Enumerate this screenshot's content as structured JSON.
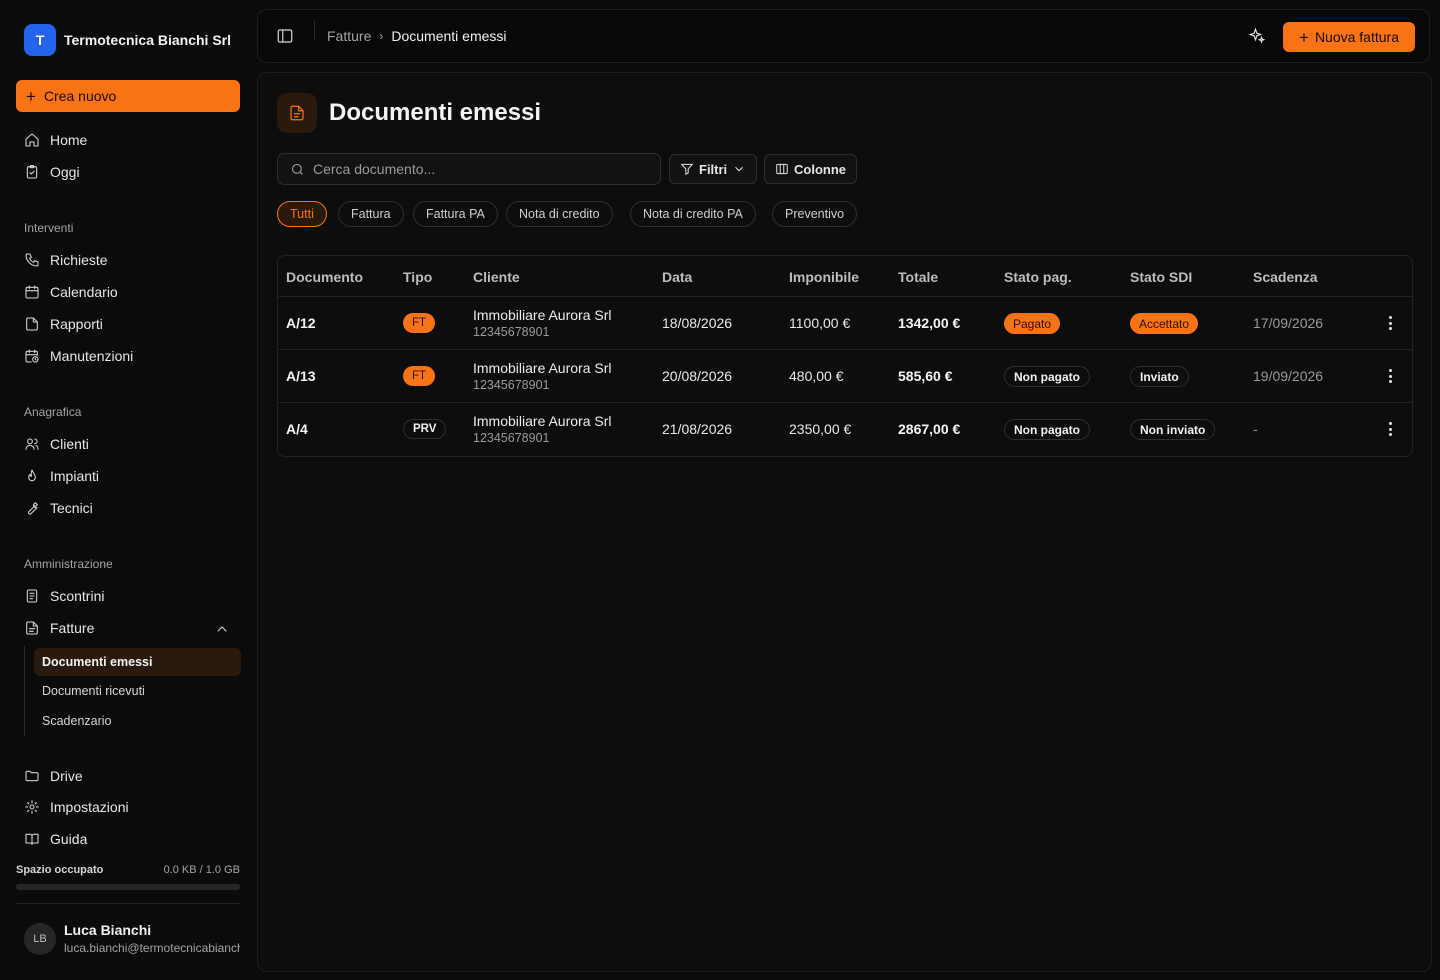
{
  "brand": {
    "initial": "T",
    "name": "Termotecnica Bianchi Srl"
  },
  "sidebar": {
    "create_label": "Crea nuovo",
    "top_items": [
      {
        "label": "Home",
        "icon": "home-icon"
      },
      {
        "label": "Oggi",
        "icon": "clipboard-icon"
      }
    ],
    "sections": [
      {
        "label": "Interventi",
        "items": [
          {
            "label": "Richieste",
            "icon": "phone-icon"
          },
          {
            "label": "Calendario",
            "icon": "calendar-icon"
          },
          {
            "label": "Rapporti",
            "icon": "file-icon"
          },
          {
            "label": "Manutenzioni",
            "icon": "calendar-clock-icon"
          }
        ]
      },
      {
        "label": "Anagrafica",
        "items": [
          {
            "label": "Clienti",
            "icon": "users-icon"
          },
          {
            "label": "Impianti",
            "icon": "flame-icon"
          },
          {
            "label": "Tecnici",
            "icon": "wrench-icon"
          }
        ]
      },
      {
        "label": "Amministrazione",
        "items": [
          {
            "label": "Scontrini",
            "icon": "receipt-icon"
          },
          {
            "label": "Fatture",
            "icon": "invoice-icon"
          }
        ]
      }
    ],
    "fatture_sub": [
      {
        "label": "Documenti emessi",
        "active": true
      },
      {
        "label": "Documenti ricevuti",
        "active": false
      },
      {
        "label": "Scadenzario",
        "active": false
      }
    ],
    "bottom_items": [
      {
        "label": "Drive",
        "icon": "folder-icon"
      },
      {
        "label": "Impostazioni",
        "icon": "gear-icon"
      },
      {
        "label": "Guida",
        "icon": "book-icon"
      }
    ],
    "storage": {
      "label": "Spazio occupato",
      "value": "0.0 KB / 1.0 GB",
      "fraction": 0
    },
    "user": {
      "initials": "LB",
      "name": "Luca Bianchi",
      "email": "luca.bianchi@termotecnicabianchi.it"
    }
  },
  "topbar": {
    "breadcrumb": {
      "parent": "Fatture",
      "current": "Documenti emessi"
    },
    "new_invoice_label": "Nuova fattura"
  },
  "main": {
    "title": "Documenti emessi",
    "search_placeholder": "Cerca documento...",
    "filters_label": "Filtri",
    "columns_label": "Colonne",
    "chips": [
      "Tutti",
      "Fattura",
      "Fattura PA",
      "Nota di credito",
      "Nota di credito PA",
      "Preventivo"
    ],
    "active_chip": 0,
    "table": {
      "headers": [
        "Documento",
        "Tipo",
        "Cliente",
        "Data",
        "Imponibile",
        "Totale",
        "Stato pag.",
        "Stato SDI",
        "Scadenza"
      ],
      "rows": [
        {
          "doc": "A/12",
          "type": "FT",
          "client": "Immobiliare Aurora Srl",
          "vat": "12345678901",
          "date": "18/08/2026",
          "taxable": "1100,00 €",
          "total": "1342,00 €",
          "pay": "Pagato",
          "pay_style": "orange",
          "sdi": "Accettato",
          "sdi_style": "orange",
          "due": "17/09/2026"
        },
        {
          "doc": "A/13",
          "type": "FT",
          "client": "Immobiliare Aurora Srl",
          "vat": "12345678901",
          "date": "20/08/2026",
          "taxable": "480,00 €",
          "total": "585,60 €",
          "pay": "Non pagato",
          "pay_style": "outline",
          "sdi": "Inviato",
          "sdi_style": "outline",
          "due": "19/09/2026"
        },
        {
          "doc": "A/4",
          "type": "PRV",
          "client": "Immobiliare Aurora Srl",
          "vat": "12345678901",
          "date": "21/08/2026",
          "taxable": "2350,00 €",
          "total": "2867,00 €",
          "pay": "Non pagato",
          "pay_style": "outline",
          "sdi": "Non inviato",
          "sdi_style": "outline",
          "due": "-"
        }
      ]
    }
  },
  "colors": {
    "accent": "#f97316",
    "brand": "#2563eb",
    "background": "#0b0b0b"
  }
}
